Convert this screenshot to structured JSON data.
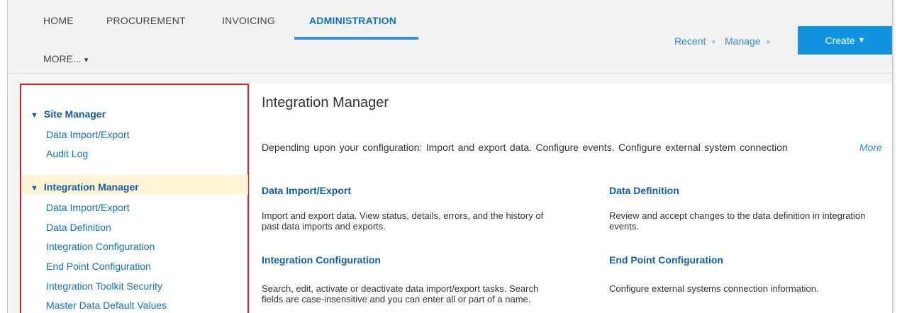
{
  "nav": {
    "tabs": [
      {
        "label": "HOME"
      },
      {
        "label": "PROCUREMENT"
      },
      {
        "label": "INVOICING"
      },
      {
        "label": "ADMINISTRATION"
      }
    ],
    "more_label": "MORE...",
    "more_caret": "▼"
  },
  "utility": {
    "recent_label": "Recent",
    "manage_label": "Manage",
    "create_label": "Create",
    "caret": "▼"
  },
  "sidebar": {
    "sections": [
      {
        "title": "Site Manager",
        "items": [
          {
            "label": "Data Import/Export"
          },
          {
            "label": "Audit Log"
          }
        ]
      },
      {
        "title": "Integration Manager",
        "items": [
          {
            "label": "Data Import/Export"
          },
          {
            "label": "Data Definition"
          },
          {
            "label": "Integration Configuration"
          },
          {
            "label": "End Point Configuration"
          },
          {
            "label": "Integration Toolkit Security"
          },
          {
            "label": "Master Data Default Values"
          }
        ]
      }
    ],
    "expanded_glyph": "▼"
  },
  "main": {
    "title": "Integration Manager",
    "description": "Depending upon your configuration: Import and export data. Configure events. Configure external system connection",
    "more_label": "More",
    "cards": [
      {
        "title": "Data Import/Export",
        "description": "Import and export data. View status, details, errors, and the history of past data imports and exports."
      },
      {
        "title": "Data Definition",
        "description": "Review and accept changes to the data definition in integration events."
      },
      {
        "title": "Integration Configuration",
        "description": "Search, edit, activate or deactivate data import/export tasks. Search fields are case-insensitive and you can enter all or part of a name."
      },
      {
        "title": "End Point Configuration",
        "description": "Configure external systems connection information."
      }
    ]
  },
  "colors": {
    "accent": "#1193e0",
    "link": "#1570bd",
    "highlight_box": "#e02020"
  }
}
